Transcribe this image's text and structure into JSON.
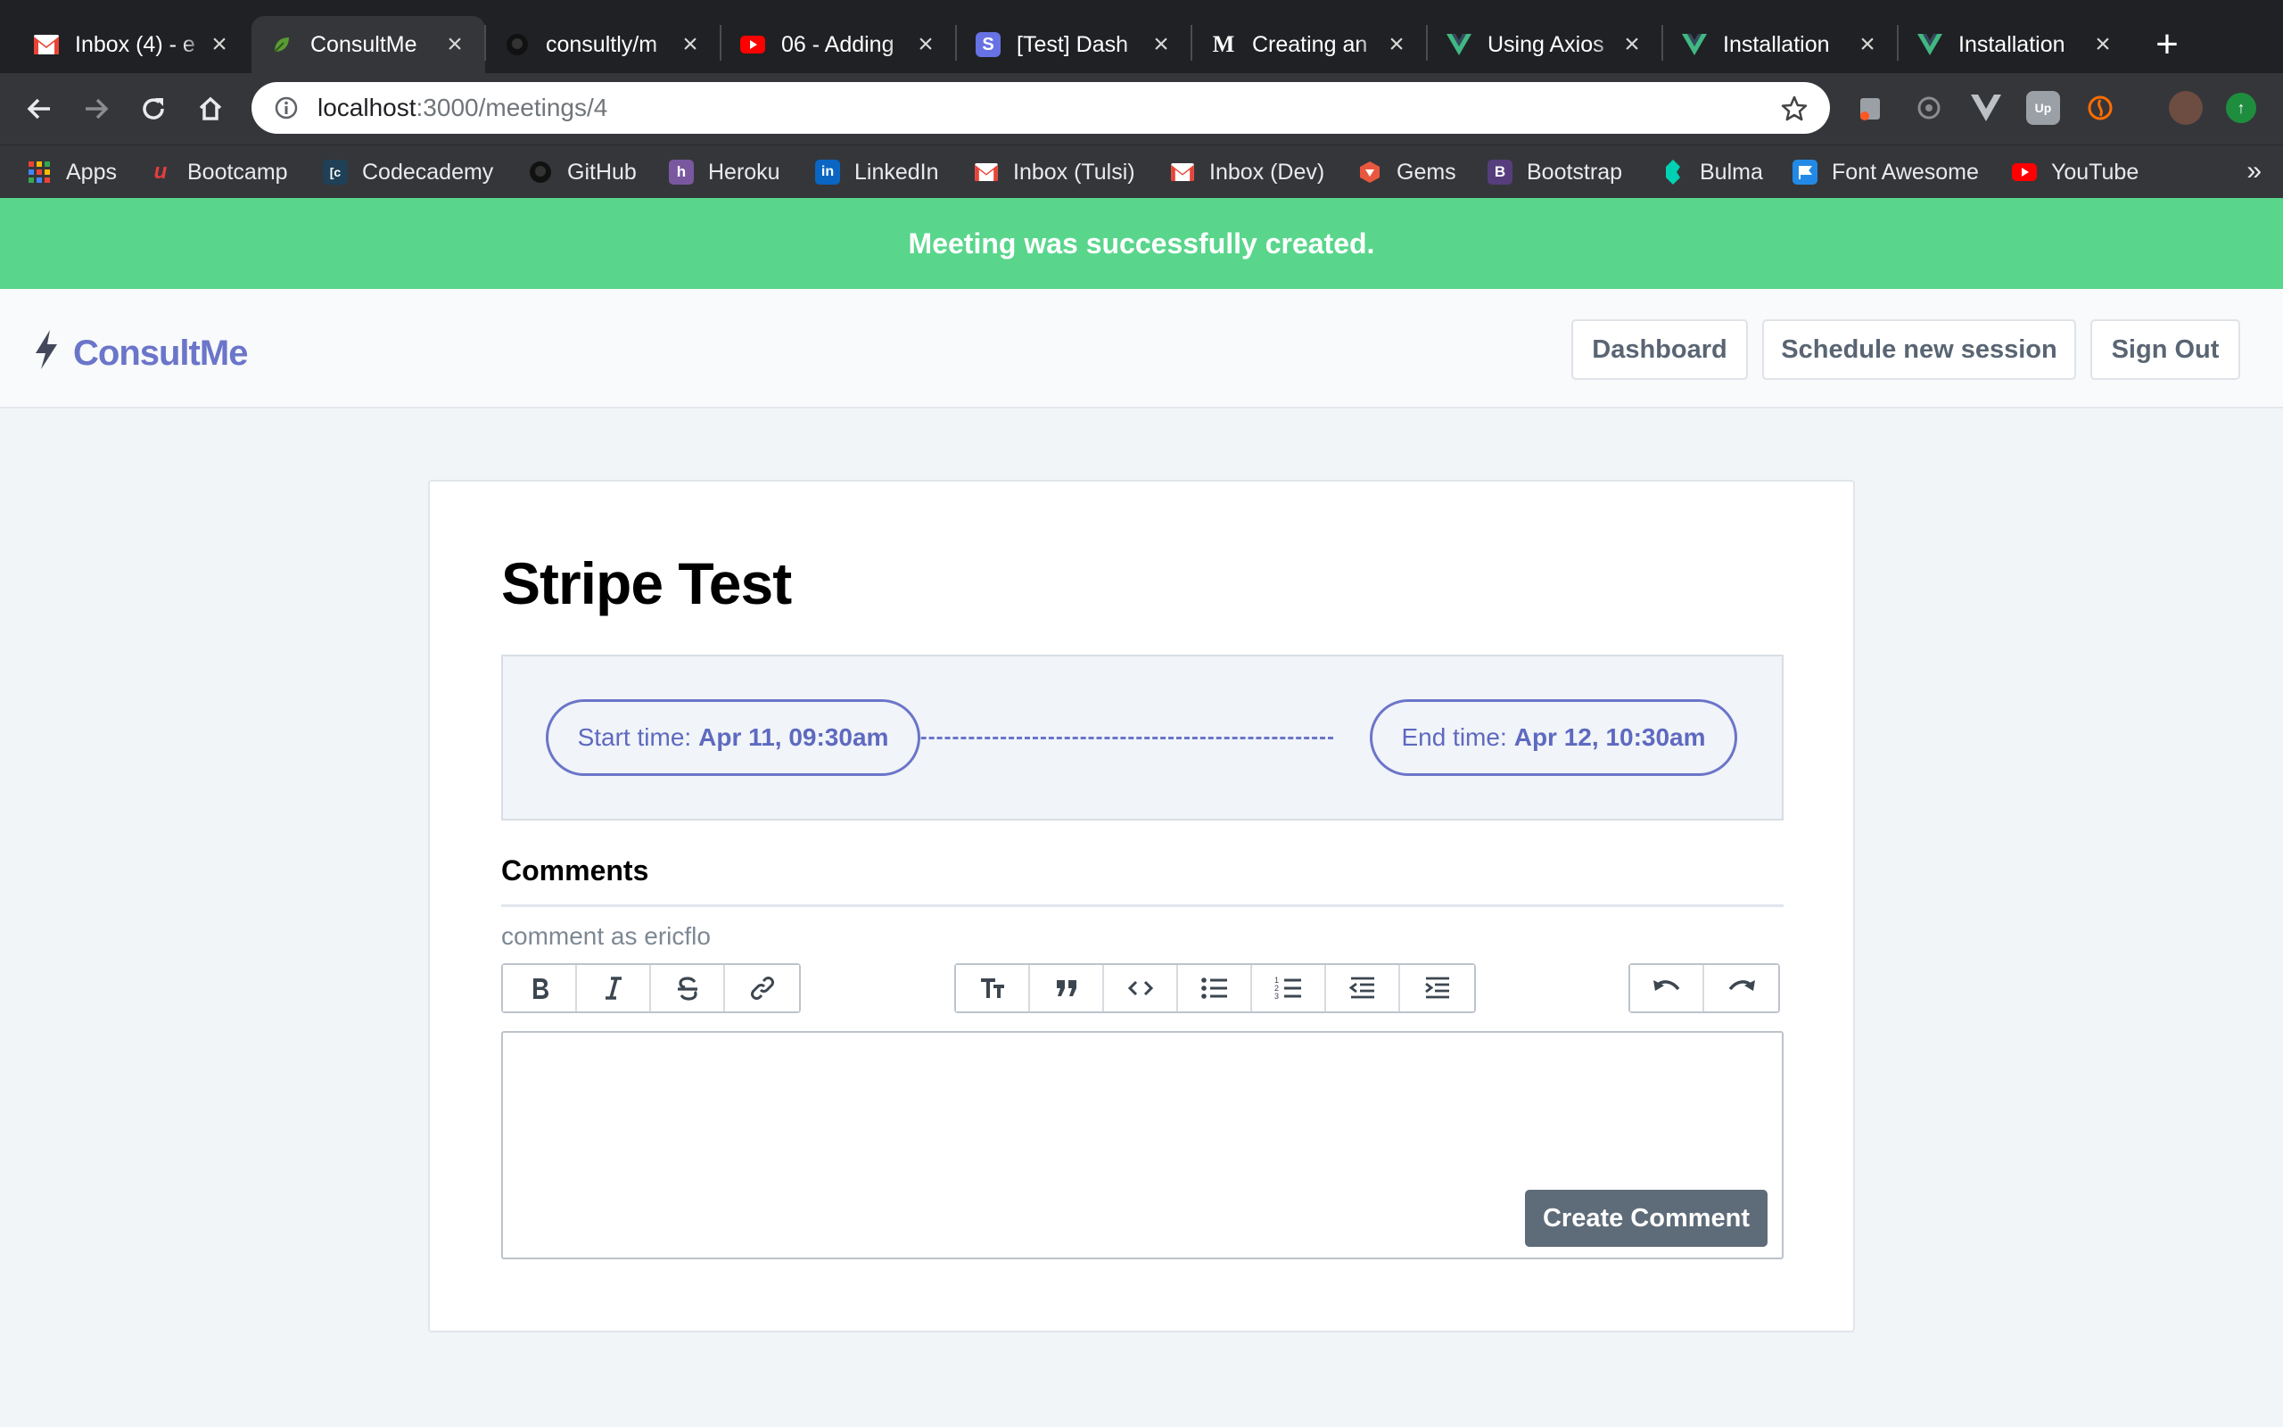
{
  "browser": {
    "tabs": [
      {
        "title": "Inbox (4) - e",
        "icon": "gmail-icon",
        "color": "#ea4335"
      },
      {
        "title": "ConsultMe",
        "icon": "leaf-icon",
        "color": "#5b9b36",
        "active": true
      },
      {
        "title": "consultly/m",
        "icon": "github-icon",
        "color": "#24292e"
      },
      {
        "title": "06 - Adding",
        "icon": "youtube-icon",
        "color": "#ff0000"
      },
      {
        "title": "[Test] Dash",
        "icon": "stripe-icon",
        "color": "#6772e5"
      },
      {
        "title": "Creating an",
        "icon": "medium-icon",
        "color": "#000000"
      },
      {
        "title": "Using Axios",
        "icon": "vue-icon",
        "color": "#41b883"
      },
      {
        "title": "Installation",
        "icon": "vue-icon",
        "color": "#41b883"
      },
      {
        "title": "Installation",
        "icon": "vue-icon",
        "color": "#41b883"
      }
    ],
    "url_host": "localhost",
    "url_rest": ":3000/meetings/4",
    "bookmarks": [
      {
        "label": "Apps",
        "icon": "apps-grid-icon",
        "color": "#ea4335"
      },
      {
        "label": "Bootcamp",
        "icon": "bootcamp-icon",
        "color": "#e53e3e"
      },
      {
        "label": "Codecademy",
        "icon": "codecademy-icon",
        "color": "#1f4056"
      },
      {
        "label": "GitHub",
        "icon": "github-icon",
        "color": "#24292e"
      },
      {
        "label": "Heroku",
        "icon": "heroku-icon",
        "color": "#79589f"
      },
      {
        "label": "LinkedIn",
        "icon": "linkedin-icon",
        "color": "#0a66c2"
      },
      {
        "label": "Inbox (Tulsi)",
        "icon": "gmail-icon",
        "color": "#ea4335"
      },
      {
        "label": "Inbox (Dev)",
        "icon": "gmail-icon",
        "color": "#ea4335"
      },
      {
        "label": "Gems",
        "icon": "ruby-icon",
        "color": "#e9573f"
      },
      {
        "label": "Bootstrap",
        "icon": "bootstrap-icon",
        "color": "#563d7c"
      },
      {
        "label": "Bulma",
        "icon": "bulma-icon",
        "color": "#00d1b2"
      },
      {
        "label": "Font Awesome",
        "icon": "flag-icon",
        "color": "#228ae6"
      },
      {
        "label": "YouTube",
        "icon": "youtube-icon",
        "color": "#ff0000"
      }
    ],
    "bookmarks_more": "»"
  },
  "flash": {
    "message": "Meeting was successfully created.",
    "color": "#59d68c"
  },
  "nav": {
    "brand": "ConsultMe",
    "dashboard": "Dashboard",
    "schedule": "Schedule new session",
    "signout": "Sign Out"
  },
  "meeting": {
    "title": "Stripe Test",
    "start_label": "Start time:",
    "start_value": "Apr 11, 09:30am",
    "end_label": "End time:",
    "end_value": "Apr 12, 10:30am"
  },
  "comments": {
    "heading": "Comments",
    "comment_as": "comment as ericflo",
    "editor_value": "",
    "submit": "Create Comment"
  },
  "colors": {
    "accent": "#6b75c9",
    "button_dark": "#5e6b78"
  }
}
